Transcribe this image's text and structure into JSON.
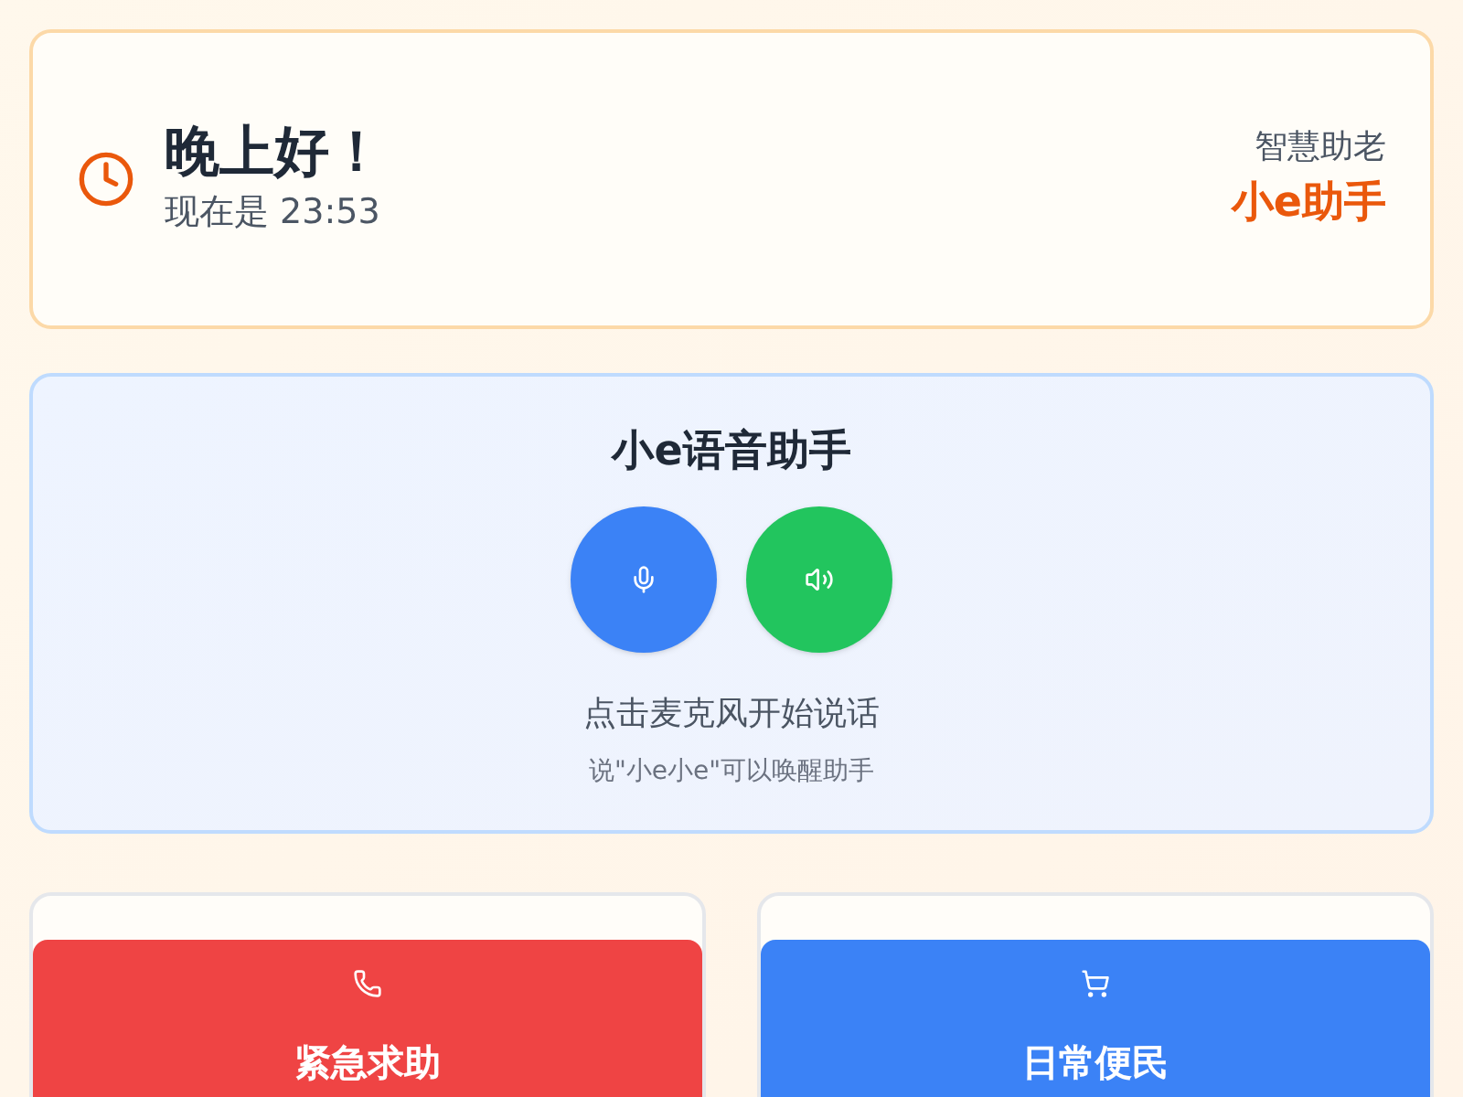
{
  "header": {
    "greeting": "晚上好！",
    "time_line": "现在是 23:53",
    "tagline": "智慧助老",
    "brand": "小e助手"
  },
  "voice": {
    "title": "小e语音助手",
    "hint": "点击麦克风开始说话",
    "wake_hint": "说\"小e小e\"可以唤醒助手"
  },
  "features": [
    {
      "kind": "emergency",
      "label": "紧急求助",
      "color": "#ef4444"
    },
    {
      "kind": "service",
      "label": "日常便民",
      "color": "#3b82f6"
    }
  ]
}
